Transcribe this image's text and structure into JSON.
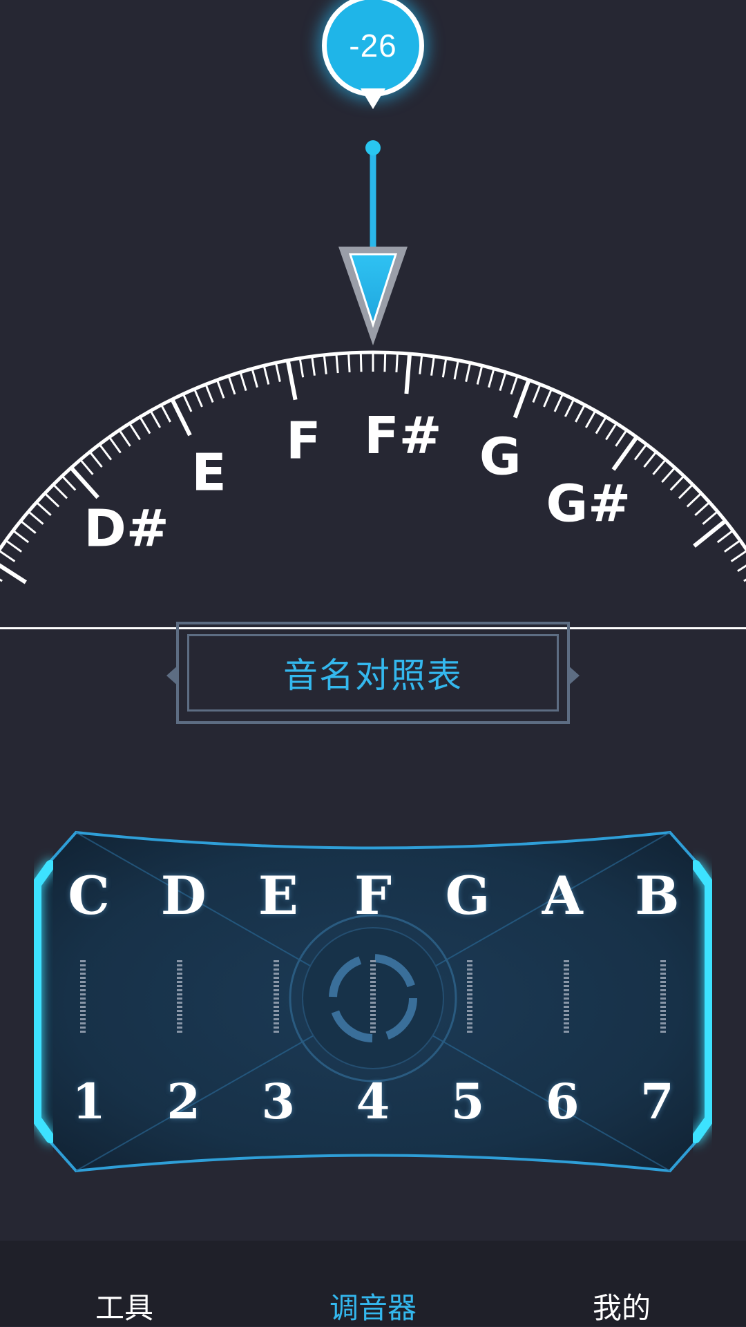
{
  "indicator": {
    "cents": "-26"
  },
  "dial": {
    "notes": [
      "D#",
      "E",
      "F",
      "F#",
      "G",
      "G#"
    ]
  },
  "note_table": {
    "label": "音名对照表"
  },
  "reference": {
    "notes": [
      "C",
      "D",
      "E",
      "F",
      "G",
      "A",
      "B"
    ],
    "numbers": [
      "1",
      "2",
      "3",
      "4",
      "5",
      "6",
      "7"
    ]
  },
  "nav": {
    "items": [
      {
        "label": "工具"
      },
      {
        "label": "调音器"
      },
      {
        "label": "我的"
      }
    ],
    "active_index": 1
  },
  "colors": {
    "background": "#262733",
    "accent": "#34b8ee",
    "needle": "#1fb5e8",
    "panel_glow": "#27d3ff"
  }
}
